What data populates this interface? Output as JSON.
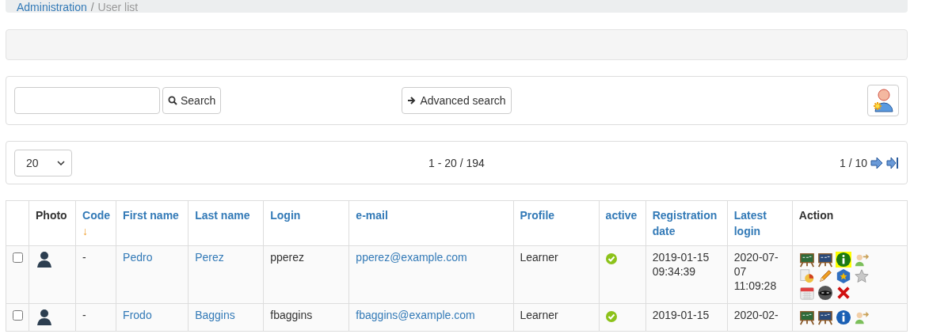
{
  "breadcrumb": [
    {
      "label": "Administration",
      "link": true
    },
    {
      "label": "User list",
      "link": false
    }
  ],
  "breadcrumb_separator": "/",
  "search": {
    "button": "Search",
    "advanced": "Advanced search"
  },
  "pagination": {
    "page_size": "20",
    "range": "1 - 20 / 194",
    "page": "1 / 10"
  },
  "table": {
    "columns": [
      {
        "label": "Photo",
        "sortable": false
      },
      {
        "label": "Code",
        "sortable": true,
        "sort_arrow": "↓"
      },
      {
        "label": "First name",
        "sortable": true
      },
      {
        "label": "Last name",
        "sortable": true
      },
      {
        "label": "Login",
        "sortable": true
      },
      {
        "label": "e-mail",
        "sortable": true
      },
      {
        "label": "Profile",
        "sortable": true
      },
      {
        "label": "active",
        "sortable": true
      },
      {
        "label": "Registration date",
        "sortable": true
      },
      {
        "label": "Latest login",
        "sortable": true
      },
      {
        "label": "Action",
        "sortable": false
      }
    ],
    "rows": [
      {
        "checked": false,
        "code": "-",
        "first_name": "Pedro",
        "last_name": "Perez",
        "login": "pperez",
        "email": "pperez@example.com",
        "profile": "Learner",
        "active": true,
        "registration_date": "2019-01-15 09:34:39",
        "latest_login": [
          "2020-07-",
          "07",
          "11:09:28"
        ],
        "actions": [
          {
            "kind": "board-green",
            "highlighted": false
          },
          {
            "kind": "board-blue",
            "highlighted": false
          },
          {
            "kind": "info-green",
            "highlighted": true
          },
          {
            "kind": "user-arrow",
            "highlighted": false
          },
          {
            "kind": "reports",
            "highlighted": false
          },
          {
            "kind": "pencil",
            "highlighted": false
          },
          {
            "kind": "hex-star",
            "highlighted": false
          },
          {
            "kind": "star",
            "highlighted": false
          },
          {
            "kind": "calendar",
            "highlighted": false
          },
          {
            "kind": "mask",
            "highlighted": false
          },
          {
            "kind": "delete",
            "highlighted": false
          }
        ]
      },
      {
        "checked": false,
        "code": "-",
        "first_name": "Frodo",
        "last_name": "Baggins",
        "login": "fbaggins",
        "email": "fbaggins@example.com",
        "profile": "Learner",
        "active": true,
        "registration_date": "2019-01-15",
        "latest_login": [
          "2020-02-"
        ],
        "actions": [
          {
            "kind": "board-green",
            "highlighted": false
          },
          {
            "kind": "board-blue",
            "highlighted": false
          },
          {
            "kind": "info-blue",
            "highlighted": false
          },
          {
            "kind": "user-arrow",
            "highlighted": false
          }
        ]
      }
    ]
  }
}
